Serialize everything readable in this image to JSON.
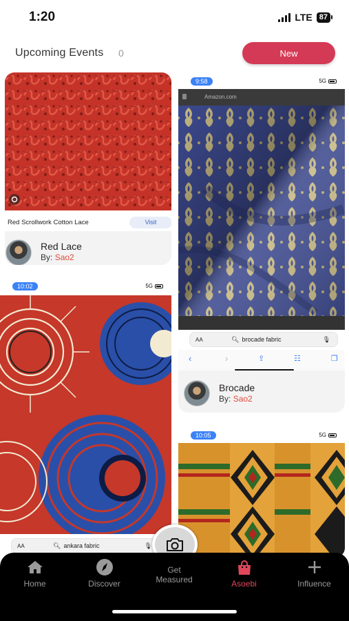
{
  "status_bar": {
    "time": "1:20",
    "network": "LTE",
    "battery": "87"
  },
  "header": {
    "title": "Upcoming Events",
    "count": "0",
    "new_label": "New"
  },
  "cards": {
    "red_lace": {
      "caption": "Red Scrollwork Cotton Lace",
      "visit_label": "Visit",
      "name": "Red Lace",
      "by_label": "By:",
      "user": "Sao2"
    },
    "brocade": {
      "mini_time": "9:58",
      "mini_net": "5G",
      "site": "Amazon.com",
      "url_aa": "AA",
      "url_query": "brocade fabric",
      "name": "Brocade",
      "by_label": "By:",
      "user": "Sao2"
    },
    "ankara": {
      "mini_time": "10:02",
      "mini_net": "5G",
      "url_aa": "AA",
      "url_query": "ankara fabric"
    },
    "kente": {
      "mini_time": "10:05",
      "mini_net": "5G"
    }
  },
  "tabs": [
    {
      "label": "Home",
      "icon": "home-icon"
    },
    {
      "label": "Discover",
      "icon": "compass-icon"
    },
    {
      "label": "Get Measured",
      "icon": "camera-icon"
    },
    {
      "label": "Asoebi",
      "icon": "shopping-bag-icon"
    },
    {
      "label": "Influence",
      "icon": "plus-icon"
    }
  ],
  "colors": {
    "accent": "#d43a55",
    "active_tab": "#e0475a",
    "user_link": "#e04a3a"
  }
}
